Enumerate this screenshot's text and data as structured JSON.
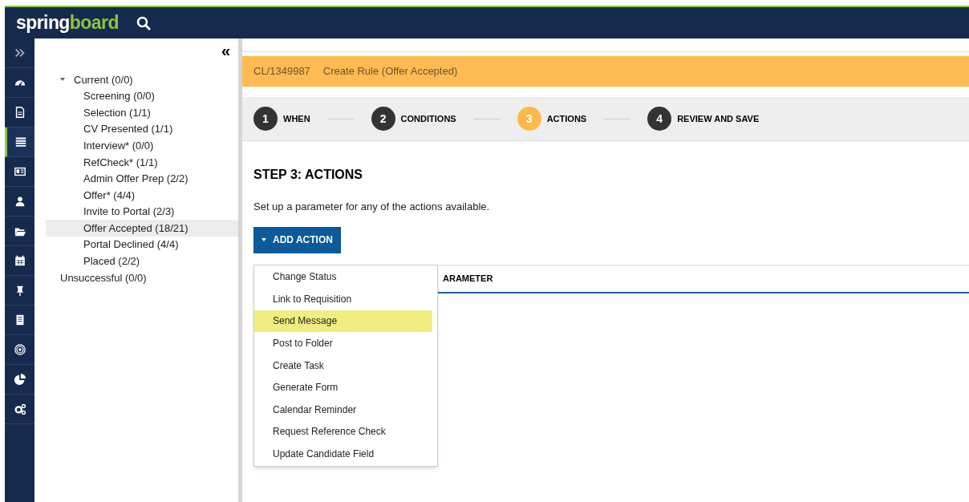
{
  "header": {
    "logo_parts": [
      {
        "text": "spring",
        "color": "#ffffff"
      },
      {
        "text": "board",
        "color": "#8cc63f"
      }
    ]
  },
  "rail": {
    "items": [
      {
        "kind": "expand",
        "selected": false
      },
      {
        "kind": "dashboard",
        "selected": false
      },
      {
        "kind": "document",
        "selected": false
      },
      {
        "kind": "list",
        "selected": true
      },
      {
        "kind": "card",
        "selected": false
      },
      {
        "kind": "person",
        "selected": false
      },
      {
        "kind": "folder",
        "selected": false
      },
      {
        "kind": "calendar",
        "selected": false
      },
      {
        "kind": "pin",
        "selected": false
      },
      {
        "kind": "building",
        "selected": false
      },
      {
        "kind": "target",
        "selected": false
      },
      {
        "kind": "pie",
        "selected": false
      },
      {
        "kind": "gears",
        "selected": false
      }
    ]
  },
  "tree": {
    "collapse_label": "«",
    "items": [
      {
        "label": "Current (0/0)",
        "expanded": true,
        "selected": false,
        "children": [
          {
            "label": "Screening (0/0)",
            "selected": false
          },
          {
            "label": "Selection (1/1)",
            "selected": false
          },
          {
            "label": "CV Presented (1/1)",
            "selected": false
          },
          {
            "label": "Interview* (0/0)",
            "selected": false
          },
          {
            "label": "RefCheck* (1/1)",
            "selected": false
          },
          {
            "label": "Admin Offer Prep (2/2)",
            "selected": false
          },
          {
            "label": "Offer* (4/4)",
            "selected": false
          },
          {
            "label": "Invite to Portal (2/3)",
            "selected": false
          },
          {
            "label": "Offer Accepted (18/21)",
            "selected": true
          },
          {
            "label": "Portal Declined (4/4)",
            "selected": false
          },
          {
            "label": "Placed (2/2)",
            "selected": false
          }
        ]
      },
      {
        "label": "Unsuccessful (0/0)",
        "selected": false
      }
    ]
  },
  "banner": {
    "reference": "CL/1349987",
    "title": "Create Rule (Offer Accepted)"
  },
  "steps": [
    {
      "number": "1",
      "label": "WHEN",
      "selected": false
    },
    {
      "number": "2",
      "label": "CONDITIONS",
      "selected": false
    },
    {
      "number": "3",
      "label": "ACTIONS",
      "selected": true
    },
    {
      "number": "4",
      "label": "REVIEW AND SAVE",
      "selected": false
    }
  ],
  "section": {
    "heading": "STEP 3: ACTIONS",
    "description": "Set up a parameter for any of the actions available."
  },
  "add_action": {
    "label": "ADD ACTION",
    "expanded": true
  },
  "table": {
    "columns": [
      "ARAMETER"
    ]
  },
  "menu": {
    "items": [
      {
        "label": "Change Status",
        "selected": false
      },
      {
        "label": "Link to Requisition",
        "selected": false
      },
      {
        "label": "Send Message",
        "selected": true
      },
      {
        "label": "Post to Folder",
        "selected": false
      },
      {
        "label": "Create Task",
        "selected": false
      },
      {
        "label": "Generate Form",
        "selected": false
      },
      {
        "label": "Calendar Reminder",
        "selected": false
      },
      {
        "label": "Request Reference Check",
        "selected": false
      },
      {
        "label": "Update Candidate Field",
        "selected": false
      }
    ]
  }
}
